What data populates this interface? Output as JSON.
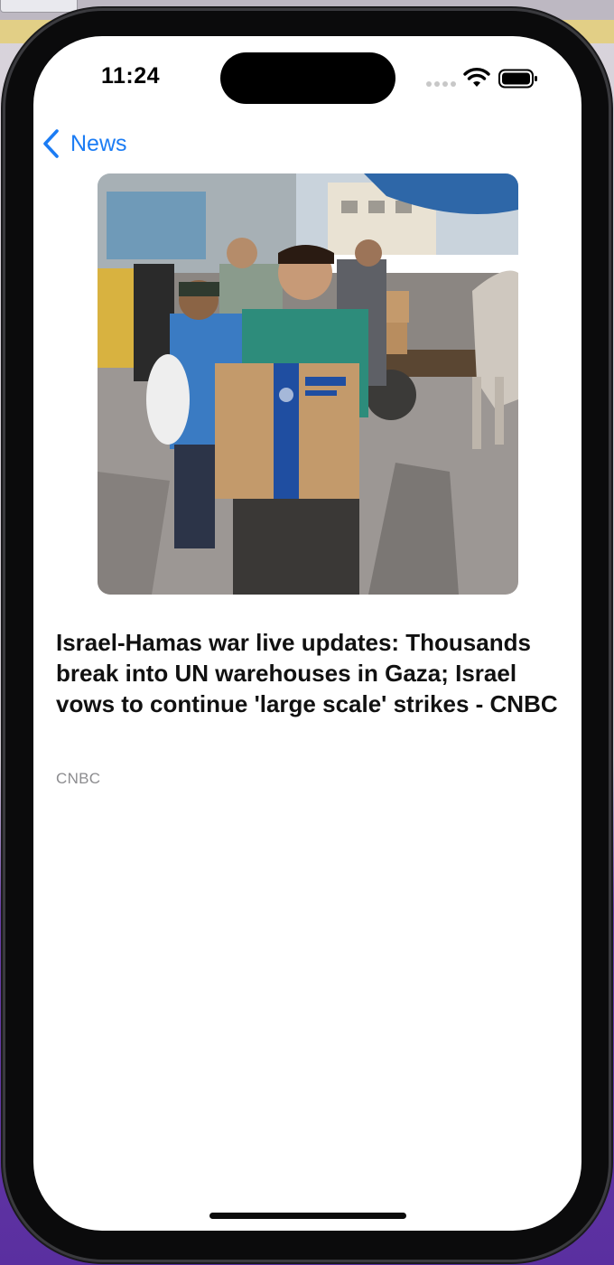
{
  "status_bar": {
    "time": "11:24",
    "icons": [
      "cellular-signal-icon",
      "wifi-icon",
      "battery-icon"
    ]
  },
  "nav": {
    "back_label": "News",
    "back_icon": "chevron-left-icon"
  },
  "article": {
    "headline": "Israel-Hamas war live updates: Thousands break into UN warehouses in Gaza; Israel vows to continue 'large scale' strikes - CNBC",
    "source": "CNBC"
  },
  "colors": {
    "accent": "#1b7cf4",
    "source_text": "#8c8c8f"
  }
}
